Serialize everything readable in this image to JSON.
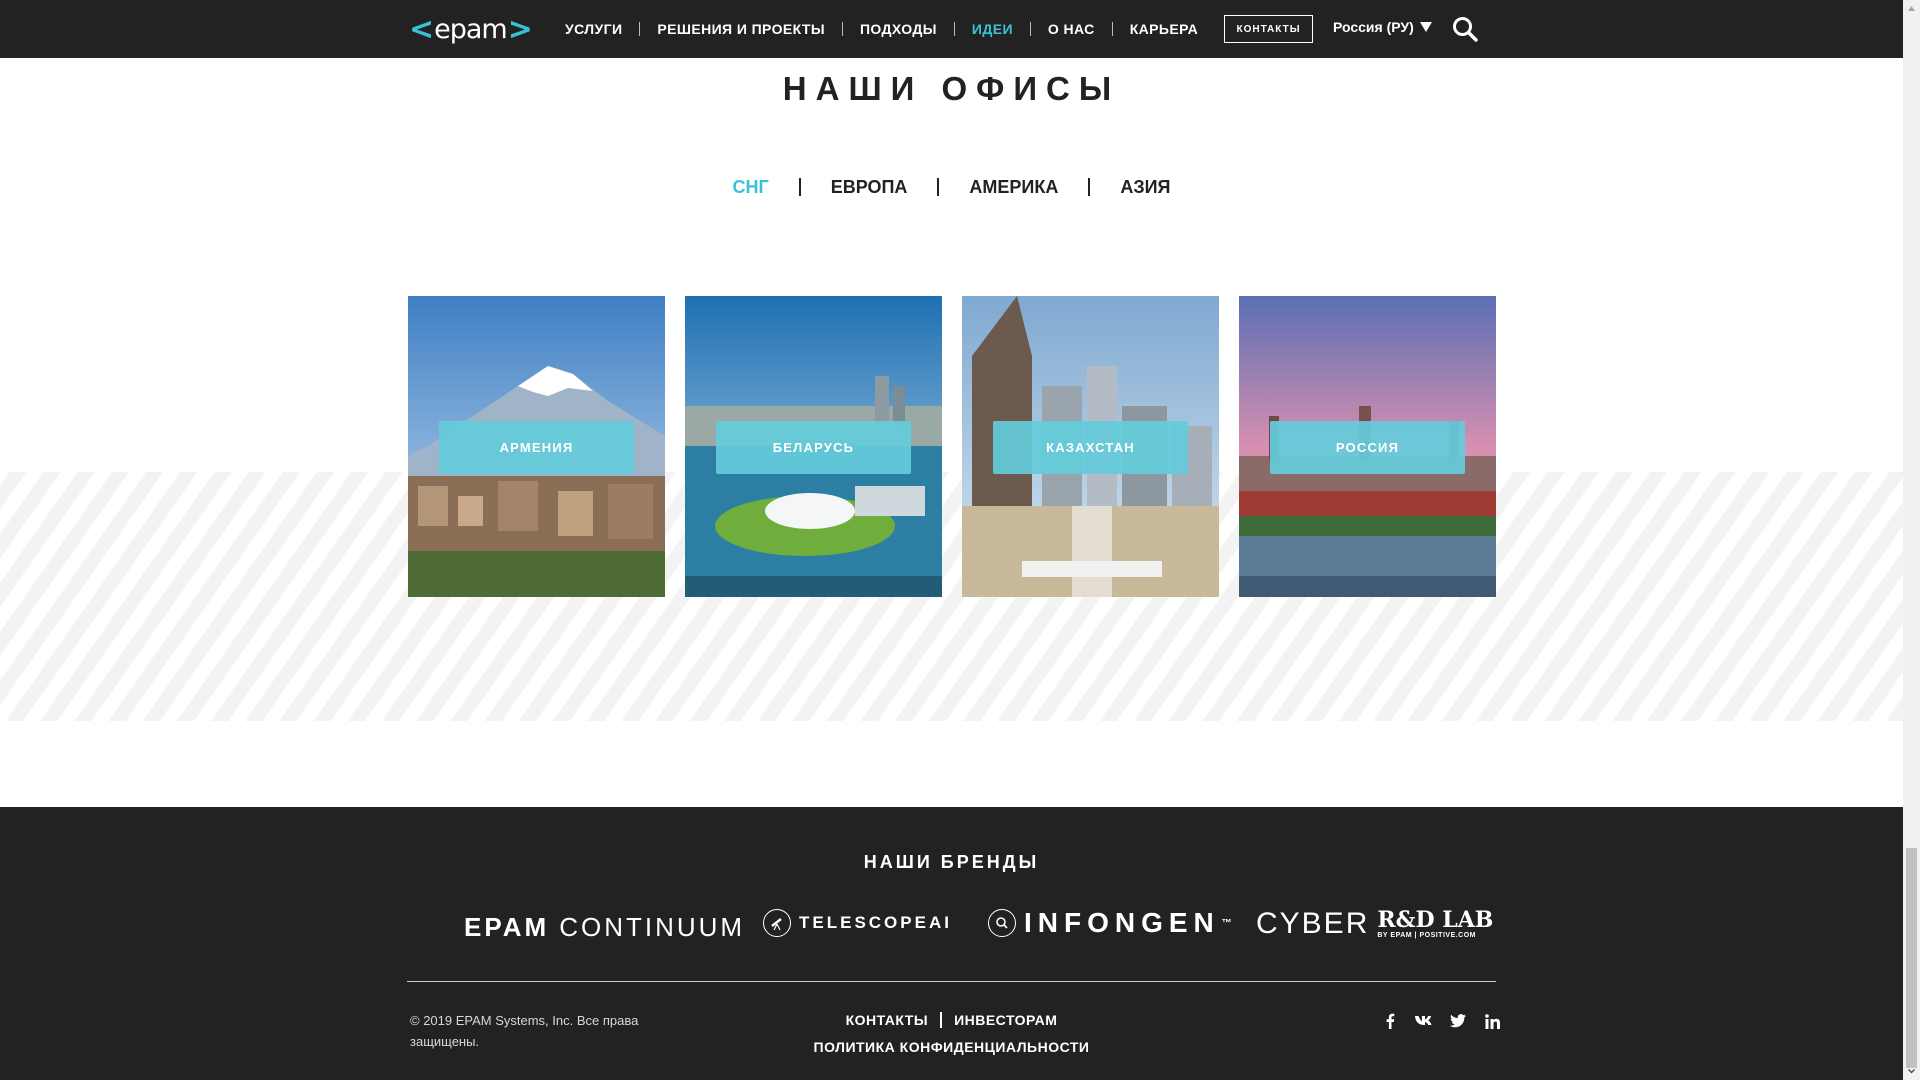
{
  "header": {
    "logo": "epam",
    "nav": [
      {
        "label": "УСЛУГИ"
      },
      {
        "label": "РЕШЕНИЯ И ПРОЕКТЫ"
      },
      {
        "label": "ПОДХОДЫ"
      },
      {
        "label": "ИДЕИ",
        "active": true
      },
      {
        "label": "О НАС"
      },
      {
        "label": "КАРЬЕРА"
      }
    ],
    "contacts_button": "КОНТАКТЫ",
    "language": "Россия (РУ)",
    "accent_color": "#39c2d7",
    "icons": {
      "search": "search-icon",
      "caret": "caret-down-icon"
    }
  },
  "offices": {
    "title": "НАШИ ОФИСЫ",
    "regions": [
      {
        "label": "СНГ",
        "active": true
      },
      {
        "label": "ЕВРОПА"
      },
      {
        "label": "АМЕРИКА"
      },
      {
        "label": "АЗИЯ"
      }
    ],
    "cards": [
      {
        "label": "АРМЕНИЯ"
      },
      {
        "label": "БЕЛАРУСЬ"
      },
      {
        "label": "КАЗАХСТАН"
      },
      {
        "label": "РОССИЯ"
      }
    ]
  },
  "footer": {
    "brands_title": "НАШИ БРЕНДЫ",
    "brands": {
      "continuum_a": "EPAM",
      "continuum_b": "CONTINUUM",
      "telescope": "TELESCOPEAI",
      "infongen": "INFONGEN",
      "infongen_tm": "™",
      "cyber": "CYBER",
      "rdlab": "R&D LAB",
      "rdlab_sub": "BY EPAM | POSITIVE.COM"
    },
    "copyright": "© 2019 EPAM Systems, Inc. Все права защищены.",
    "links": {
      "contacts": "КОНТАКТЫ",
      "investors": "ИНВЕСТОРАМ",
      "privacy": "ПОЛИТИКА КОНФИДЕНЦИАЛЬНОСТИ"
    },
    "social": {
      "facebook": "f",
      "vk": "vk",
      "twitter": "twitter-icon",
      "linkedin": "in"
    },
    "background": "#222222"
  }
}
